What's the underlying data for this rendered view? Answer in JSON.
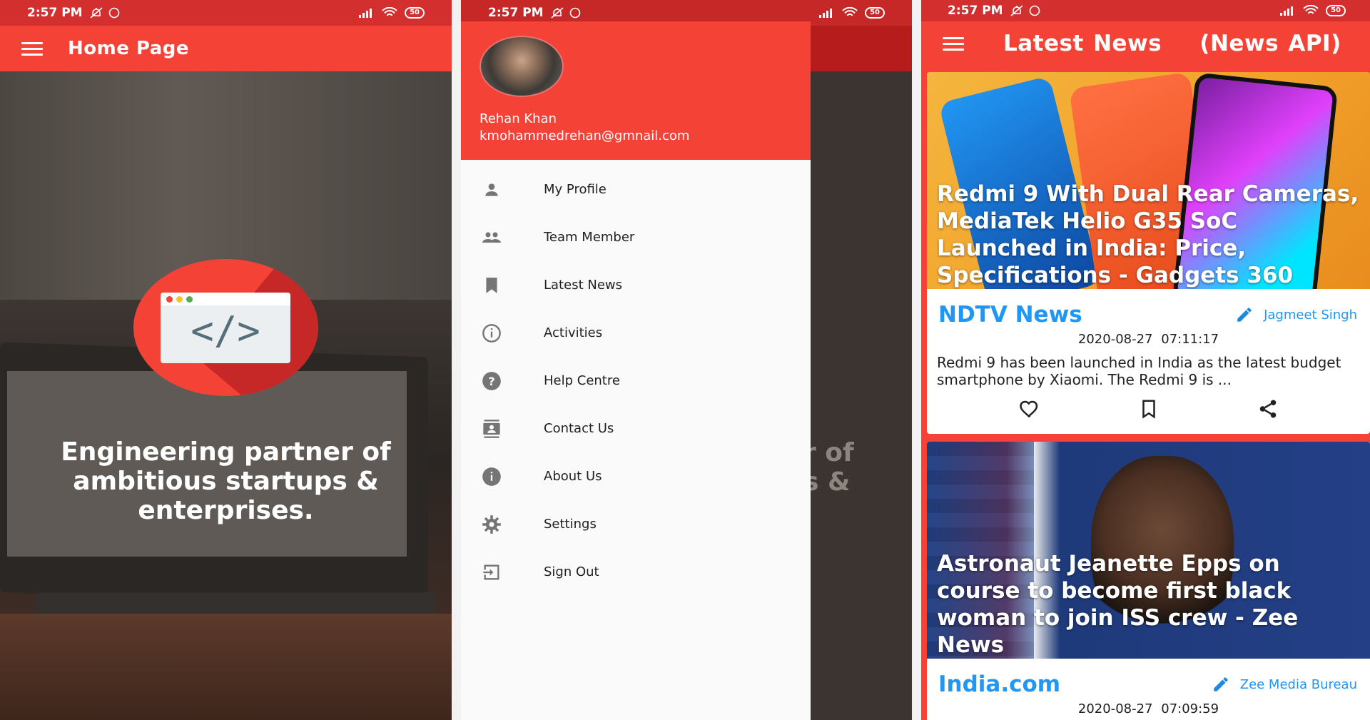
{
  "status_bar": {
    "time": "2:57 PM",
    "battery": "50"
  },
  "home": {
    "title": "Home Page",
    "logo_code": "</>",
    "tagline": "Engineering partner of ambitious startups & enterprises."
  },
  "drawer": {
    "user_name": "Rehan Khan",
    "user_email": "kmohammedrehan@gmnail.com",
    "bg_partial_text_1": "r of",
    "bg_partial_text_2": "s &",
    "items": [
      {
        "label": "My Profile",
        "icon": "person-icon"
      },
      {
        "label": "Team Member",
        "icon": "group-icon"
      },
      {
        "label": "Latest News",
        "icon": "bookmark-icon"
      },
      {
        "label": "Activities",
        "icon": "info-outline-icon"
      },
      {
        "label": "Help Centre",
        "icon": "help-icon"
      },
      {
        "label": "Contact Us",
        "icon": "contacts-icon"
      },
      {
        "label": "About Us",
        "icon": "info-icon"
      },
      {
        "label": "Settings",
        "icon": "gear-icon"
      },
      {
        "label": "Sign Out",
        "icon": "exit-icon"
      }
    ]
  },
  "news": {
    "title": "Latest News    (News API)",
    "articles": [
      {
        "headline": "Redmi 9 With Dual Rear Cameras, MediaTek Helio G35 SoC Launched in India: Price, Specifications - Gadgets 360",
        "source": "NDTV News",
        "author": "Jagmeet Singh",
        "date": "2020-08-27 07:11:17",
        "description": "Redmi 9 has been launched in India as the latest budget smartphone by Xiaomi. The Redmi 9 is ..."
      },
      {
        "headline": "Astronaut Jeanette Epps on course to become first black woman to join ISS crew - Zee News",
        "source": "India.com",
        "author": "Zee Media Bureau",
        "date": "2020-08-27 07:09:59"
      }
    ]
  },
  "colors": {
    "primary": "#f44336",
    "status": "#d32f2f",
    "accent": "#2196f3"
  }
}
